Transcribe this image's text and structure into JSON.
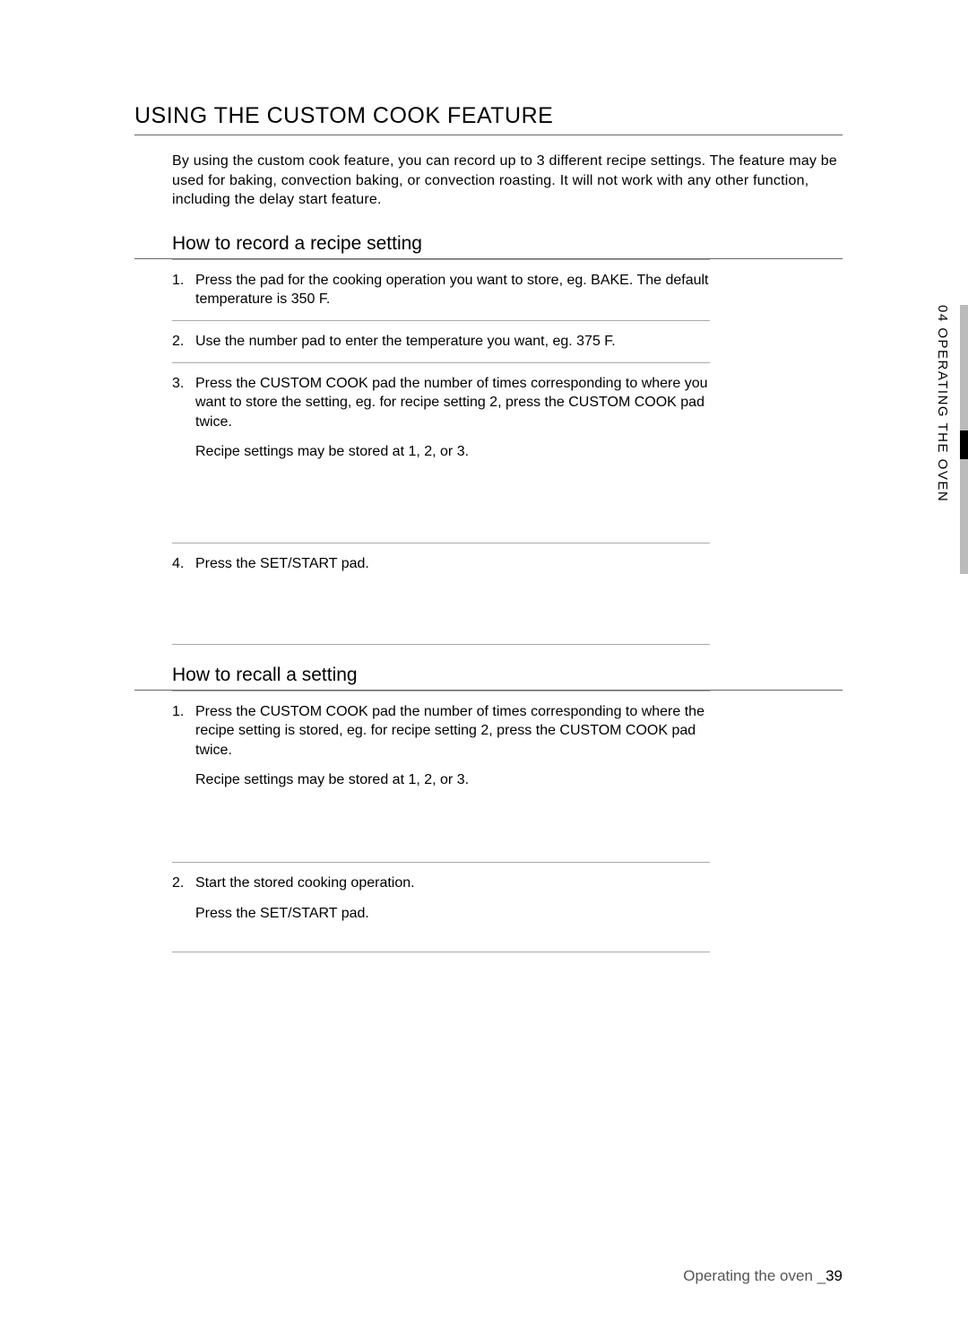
{
  "heading": "USING THE CUSTOM COOK FEATURE",
  "intro": "By using the custom cook feature, you can record up to 3 different recipe settings. The feature may be used for baking, convection baking, or convection roasting. It will not work with any other function, including the delay start feature.",
  "section1": {
    "title": "How to record a recipe setting",
    "steps": [
      {
        "text": "Press the pad for the cooking operation you want to store, eg. BAKE. The default temperature is 350 F."
      },
      {
        "text": "Use the number pad to enter the temperature you want, eg. 375 F."
      },
      {
        "text": "Press the CUSTOM COOK pad the number of times corresponding to where you want to store the setting, eg. for recipe setting 2, press the CUSTOM COOK pad twice.",
        "sub": "Recipe settings may be stored at 1, 2, or 3."
      },
      {
        "text": "Press the SET/START pad."
      }
    ]
  },
  "section2": {
    "title": "How to recall a setting",
    "steps": [
      {
        "text": "Press the CUSTOM COOK pad the number of times corresponding to where the recipe setting is stored, eg. for recipe setting 2, press the CUSTOM COOK pad twice.",
        "sub": "Recipe settings may be stored at 1, 2, or 3."
      },
      {
        "text": "Start the stored cooking operation.",
        "sub": "Press the SET/START pad."
      }
    ]
  },
  "sideLabel": "04 OPERATING THE OVEN",
  "footer": {
    "text": "Operating the oven _",
    "page": "39"
  }
}
